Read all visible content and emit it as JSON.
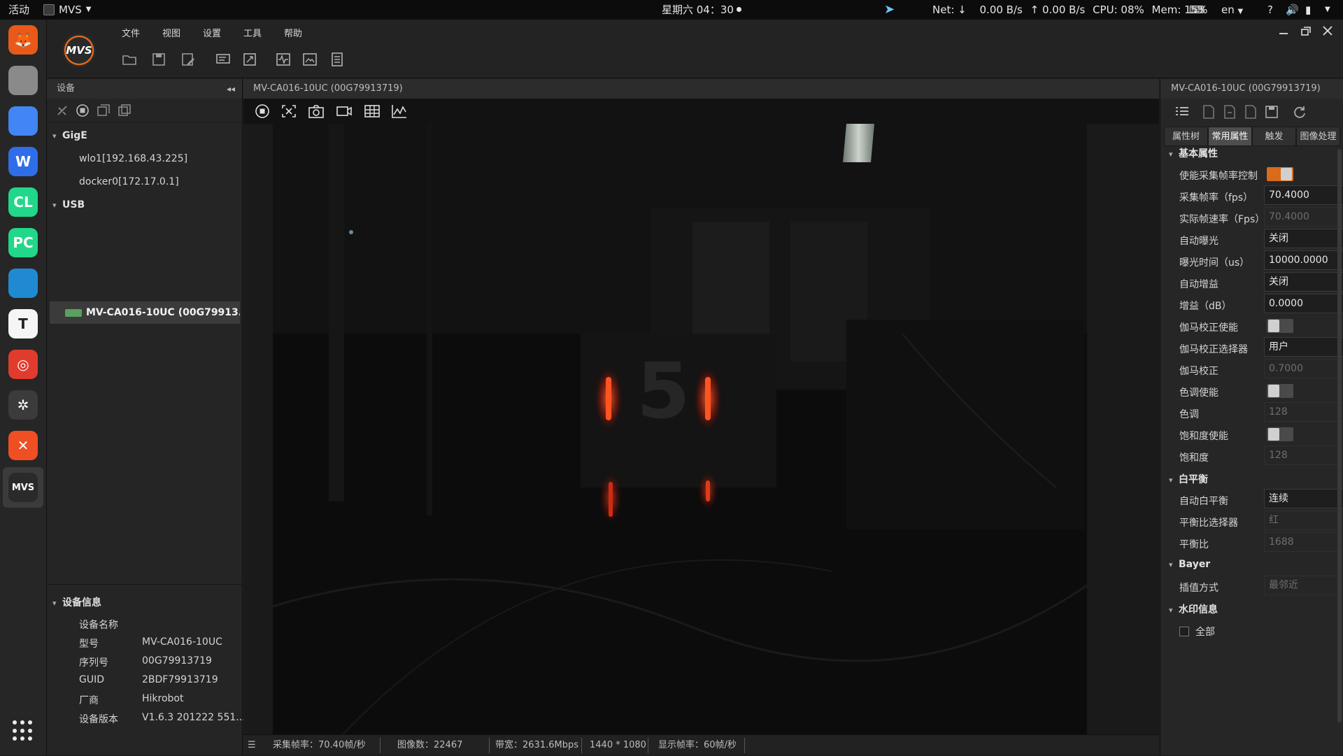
{
  "topbar": {
    "activities": "活动",
    "app_name": "MVS",
    "clock": "星期六 04：30",
    "net_label": "Net: ↓",
    "net_down": "0.00 B/s",
    "net_up": "↑  0.00 B/s",
    "cpu": "CPU: 08%",
    "mem": "Mem: 15%",
    "lang": "en",
    "help": "?"
  },
  "dock": {
    "items": [
      {
        "name": "firefox-icon",
        "color": "#e8591a",
        "glyph": "🦊"
      },
      {
        "name": "files-icon",
        "color": "#8a8a8a",
        "glyph": ""
      },
      {
        "name": "chrome-icon",
        "color": "#4285f4",
        "glyph": ""
      },
      {
        "name": "wps-icon",
        "color": "#2f6ee8",
        "glyph": "W"
      },
      {
        "name": "clion-icon",
        "color": "#21d789",
        "glyph": "CL"
      },
      {
        "name": "pycharm-icon",
        "color": "#21d789",
        "glyph": "PC"
      },
      {
        "name": "vscode-icon",
        "color": "#1f8ad2",
        "glyph": ""
      },
      {
        "name": "typora-icon",
        "color": "#f5f5f5",
        "glyph": "T"
      },
      {
        "name": "netease-music-icon",
        "color": "#e13b2e",
        "glyph": "◎"
      },
      {
        "name": "yuque-icon",
        "color": "#3b3b3b",
        "glyph": "✲"
      },
      {
        "name": "xmind-icon",
        "color": "#f04e23",
        "glyph": "✕"
      },
      {
        "name": "mvs-icon",
        "color": "#2a2a2a",
        "glyph": "MVS"
      }
    ]
  },
  "menu": {
    "file": "文件",
    "view": "视图",
    "settings": "设置",
    "tools": "工具",
    "help": "帮助",
    "logo": "MVS"
  },
  "device_panel": {
    "title": "设备",
    "groups": {
      "gige": "GigE",
      "usb": "USB"
    },
    "gige_items": [
      "wlo1[192.168.43.225]",
      "docker0[172.17.0.1]"
    ],
    "usb_device": "MV-CA016-10UC (00G79913...",
    "info_title": "设备信息",
    "info": [
      {
        "key": "设备名称",
        "value": ""
      },
      {
        "key": "型号",
        "value": "MV-CA016-10UC"
      },
      {
        "key": "序列号",
        "value": "00G79913719"
      },
      {
        "key": "GUID",
        "value": "2BDF79913719"
      },
      {
        "key": "厂商",
        "value": "Hikrobot"
      },
      {
        "key": "设备版本",
        "value": "V1.6.3 201222 551..."
      }
    ]
  },
  "view": {
    "title": "MV-CA016-10UC (00G79913719)",
    "status": {
      "fps": "采集帧率：70.40帧/秒",
      "image_count": "图像数：22467",
      "bandwidth": "带宽：2631.6Mbps",
      "resolution": "1440 * 1080",
      "display_fps": "显示帧率：60帧/秒"
    }
  },
  "props": {
    "title": "MV-CA016-10UC (00G79913719)",
    "tabs": [
      "属性树",
      "常用属性",
      "触发",
      "图像处理"
    ],
    "active_tab": 1,
    "sections": {
      "basic": "基本属性",
      "white_balance": "白平衡",
      "bayer": "Bayer",
      "watermark": "水印信息"
    },
    "rows": {
      "fps_enable_label": "使能采集帧率控制",
      "fps_enable_on": true,
      "fps_label": "采集帧率（fps）",
      "fps_value": "70.4000",
      "actual_fps_label": "实际帧速率（Fps）",
      "actual_fps_value": "70.4000",
      "auto_exposure_label": "自动曝光",
      "auto_exposure_value": "关闭",
      "exposure_label": "曝光时间（us）",
      "exposure_value": "10000.0000",
      "auto_gain_label": "自动增益",
      "auto_gain_value": "关闭",
      "gain_label": "增益（dB）",
      "gain_value": "0.0000",
      "gamma_enable_label": "伽马校正使能",
      "gamma_selector_label": "伽马校正选择器",
      "gamma_selector_value": "用户",
      "gamma_label": "伽马校正",
      "gamma_value": "0.7000",
      "hue_enable_label": "色调使能",
      "hue_label": "色调",
      "hue_value": "128",
      "sat_enable_label": "饱和度使能",
      "sat_label": "饱和度",
      "sat_value": "128",
      "awb_label": "自动白平衡",
      "awb_value": "连续",
      "ratio_selector_label": "平衡比选择器",
      "ratio_selector_value": "红",
      "ratio_label": "平衡比",
      "ratio_value": "1688",
      "interp_label": "插值方式",
      "interp_value": "最邻近",
      "all_label": "全部"
    }
  },
  "colors": {
    "accent": "#d96b1a",
    "selected_row": "#3b3b3b",
    "led_red": "#ff2a10"
  }
}
